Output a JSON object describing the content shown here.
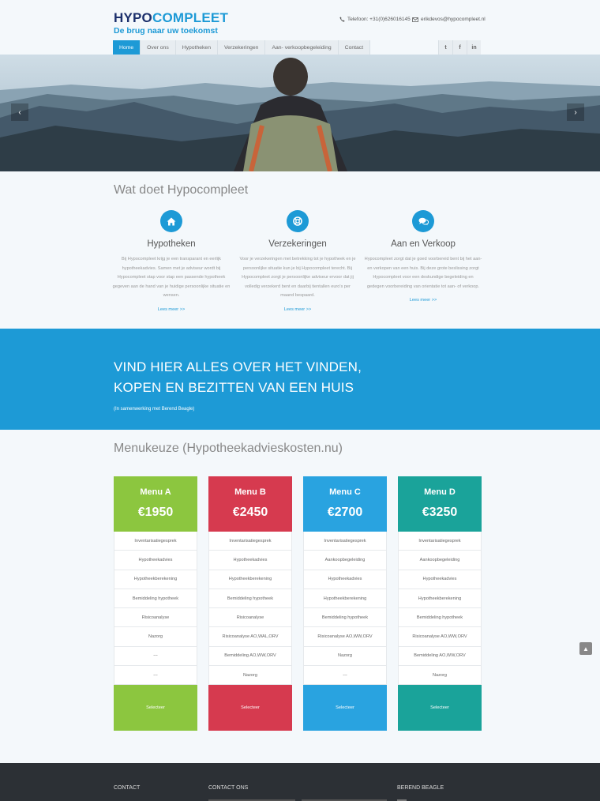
{
  "brand": {
    "name_dark": "HYPO",
    "name_light": "COMPLEET",
    "tagline": "De brug naar uw toekomst"
  },
  "header": {
    "phone_icon": "phone-icon",
    "phone": "Telefoon: +31(0)626016145",
    "mail_icon": "envelope-icon",
    "email": "erikdevos@hypocompleet.nl"
  },
  "nav": {
    "items": [
      {
        "label": "Home",
        "active": true
      },
      {
        "label": "Over ons"
      },
      {
        "label": "Hypotheken"
      },
      {
        "label": "Verzekeringen"
      },
      {
        "label": "Aan- verkoopbegeleiding"
      },
      {
        "label": "Contact"
      }
    ]
  },
  "social": {
    "twitter": "t",
    "facebook": "f",
    "linkedin": "in"
  },
  "hero": {
    "prev": "‹",
    "next": "›"
  },
  "services": {
    "title": "Wat doet Hypocompleet",
    "items": [
      {
        "icon": "home-icon",
        "title": "Hypotheken",
        "text": "Bij Hypocompleet krijg je een transparant en eerlijk hypotheekadvies. Samen met je adviseur wordt bij Hypocompleet stap voor stap een passende hypotheek gegeven aan de hand van je huidige persoonlijke situatie en wensen.",
        "more": "Lees meer >>"
      },
      {
        "icon": "lifebuoy-icon",
        "title": "Verzekeringen",
        "text": "Voor je verzekeringen met betrekking tot je hypotheek en je persoonlijke situatie kun je bij Hypocompleet terecht. Bij Hypocompleet zorgt je persoonlijke adviseur ervoor dat jij volledig verzekerd bent en daarbij tientallen euro's per maand bespaard.",
        "more": "Lees meer >>"
      },
      {
        "icon": "chat-icon",
        "title": "Aan en Verkoop",
        "text": "Hypocompleet zorgt dat je goed voorbereid bent bij het aan- en verkopen van een huis. Bij deze grote beslissing zorgt Hypocompleet voor een deskundige begeleiding en gedegen voorbereiding van orientatie tot aan- of verkoop.",
        "more": "Lees meer >>"
      }
    ]
  },
  "banner": {
    "line1": "VIND HIER ALLES OVER HET VINDEN,",
    "line2": "KOPEN EN BEZITTEN VAN EEN HUIS",
    "sub": "(In samenwerking met Berend Beagle)"
  },
  "menus": {
    "title": "Menukeuze (Hypotheekadvieskosten.nu)",
    "plans": [
      {
        "name": "Menu A",
        "price": "€1950",
        "color": "#8cc63f",
        "rows": [
          "Inventarisatiegesprek",
          "Hypotheekadvies",
          "Hypotheekberekening",
          "Bemiddeling hypotheek",
          "Risicoanalyse",
          "Nazorg",
          "---",
          "---"
        ],
        "select": "Selecteer"
      },
      {
        "name": "Menu B",
        "price": "€2450",
        "color": "#d63a4f",
        "rows": [
          "Inventarisatiegesprek",
          "Hypotheekadvies",
          "Hypotheekberekening",
          "Bemiddeling hypotheek",
          "Risicoanalyse",
          "Risicoanalyse AO,WAL,ORV",
          "Bemiddeling AO,WW,ORV",
          "Nazorg"
        ],
        "select": "Selecteer"
      },
      {
        "name": "Menu C",
        "price": "€2700",
        "color": "#29a3e0",
        "rows": [
          "Inventarisatiegesprek",
          "Aankoopbegeleiding",
          "Hypotheekadvies",
          "Hypotheekberekening",
          "Bemiddeling hypotheek",
          "Risicoanalyse AO,WW,ORV",
          "Nazorg",
          "---"
        ],
        "select": "Selecteer"
      },
      {
        "name": "Menu D",
        "price": "€3250",
        "color": "#1aa39a",
        "rows": [
          "Inventarisatiegesprek",
          "Aankoopbegeleiding",
          "Hypotheekadvies",
          "Hypotheekberekening",
          "Bemiddeling hypotheek",
          "Risicoanalyse AO,WW,ORV",
          "Bemiddeling AO,WW,ORV",
          "Nazorg"
        ],
        "select": "Selecteer"
      }
    ]
  },
  "scroll_top": "▲",
  "footer": {
    "col1": "CONTACT",
    "col2": "CONTACT ONS",
    "col3": "BEREND BEAGLE"
  }
}
